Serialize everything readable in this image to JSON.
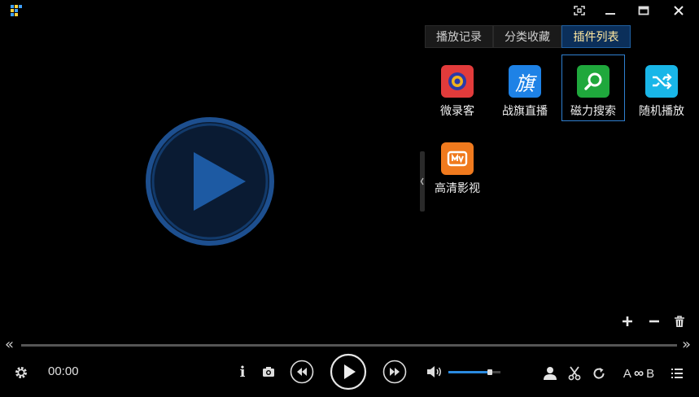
{
  "window": {
    "buttons": [
      "screenshot-mode",
      "minimize",
      "maximize",
      "close"
    ]
  },
  "tabs": [
    {
      "label": "播放记录",
      "active": false
    },
    {
      "label": "分类收藏",
      "active": false
    },
    {
      "label": "插件列表",
      "active": true
    }
  ],
  "plugins": [
    {
      "label": "微录客",
      "icon": "camera-lens-icon",
      "color": "#e23b3b"
    },
    {
      "label": "战旗直播",
      "icon": "flag-char-icon",
      "color": "#1e82e6",
      "glyph": "旗"
    },
    {
      "label": "磁力搜索",
      "icon": "magnifier-icon",
      "color": "#1fa83c",
      "selected": true
    },
    {
      "label": "随机播放",
      "icon": "shuffle-icon",
      "color": "#19b6e8"
    },
    {
      "label": "高清影视",
      "icon": "mango-tv-icon",
      "color": "#f07a1e"
    }
  ],
  "plugin_actions": [
    "add",
    "remove",
    "delete"
  ],
  "player": {
    "time": "00:00",
    "progress": 0,
    "volume": 0.8,
    "ab_label": "A",
    "ab_inf": "∞",
    "ab_label2": "B"
  },
  "colors": {
    "accent": "#2a8be0",
    "tab_active_bg": "#0b2f5a",
    "tab_active_text": "#ffe8a0"
  }
}
